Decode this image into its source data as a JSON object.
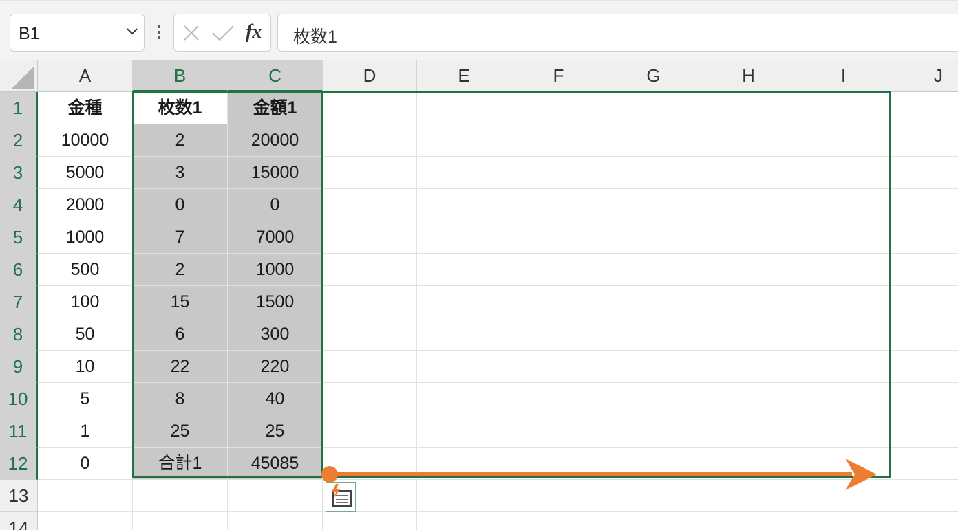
{
  "formula_bar": {
    "name_box_value": "B1",
    "cancel_icon": "x-icon",
    "enter_icon": "check-icon",
    "fx_label": "fx",
    "formula_value": "枚数1"
  },
  "columns": [
    "A",
    "B",
    "C",
    "D",
    "E",
    "F",
    "G",
    "H",
    "I",
    "J"
  ],
  "selected_columns": [
    "B",
    "C"
  ],
  "rows": [
    "1",
    "2",
    "3",
    "4",
    "5",
    "6",
    "7",
    "8",
    "9",
    "10",
    "11",
    "12",
    "13",
    "14"
  ],
  "selected_rows": [
    "1",
    "2",
    "3",
    "4",
    "5",
    "6",
    "7",
    "8",
    "9",
    "10",
    "11",
    "12"
  ],
  "active_cell": "B1",
  "selection_range": "B1:C12",
  "cells": {
    "A": [
      "金種",
      "10000",
      "5000",
      "2000",
      "1000",
      "500",
      "100",
      "50",
      "10",
      "5",
      "1",
      "0"
    ],
    "B": [
      "枚数1",
      "2",
      "3",
      "0",
      "7",
      "2",
      "15",
      "6",
      "22",
      "8",
      "25",
      "合計1"
    ],
    "C": [
      "金額1",
      "20000",
      "15000",
      "0",
      "7000",
      "1000",
      "1500",
      "300",
      "220",
      "40",
      "25",
      "45085"
    ]
  },
  "bold_row": 1,
  "colors": {
    "accent": "#217346",
    "arrow": "#ed7d31",
    "selection_fill": "#c8c8c8"
  },
  "overlay": {
    "arrow_icon": "orange-right-arrow",
    "quick_analysis_icon": "quick-analysis-icon"
  }
}
